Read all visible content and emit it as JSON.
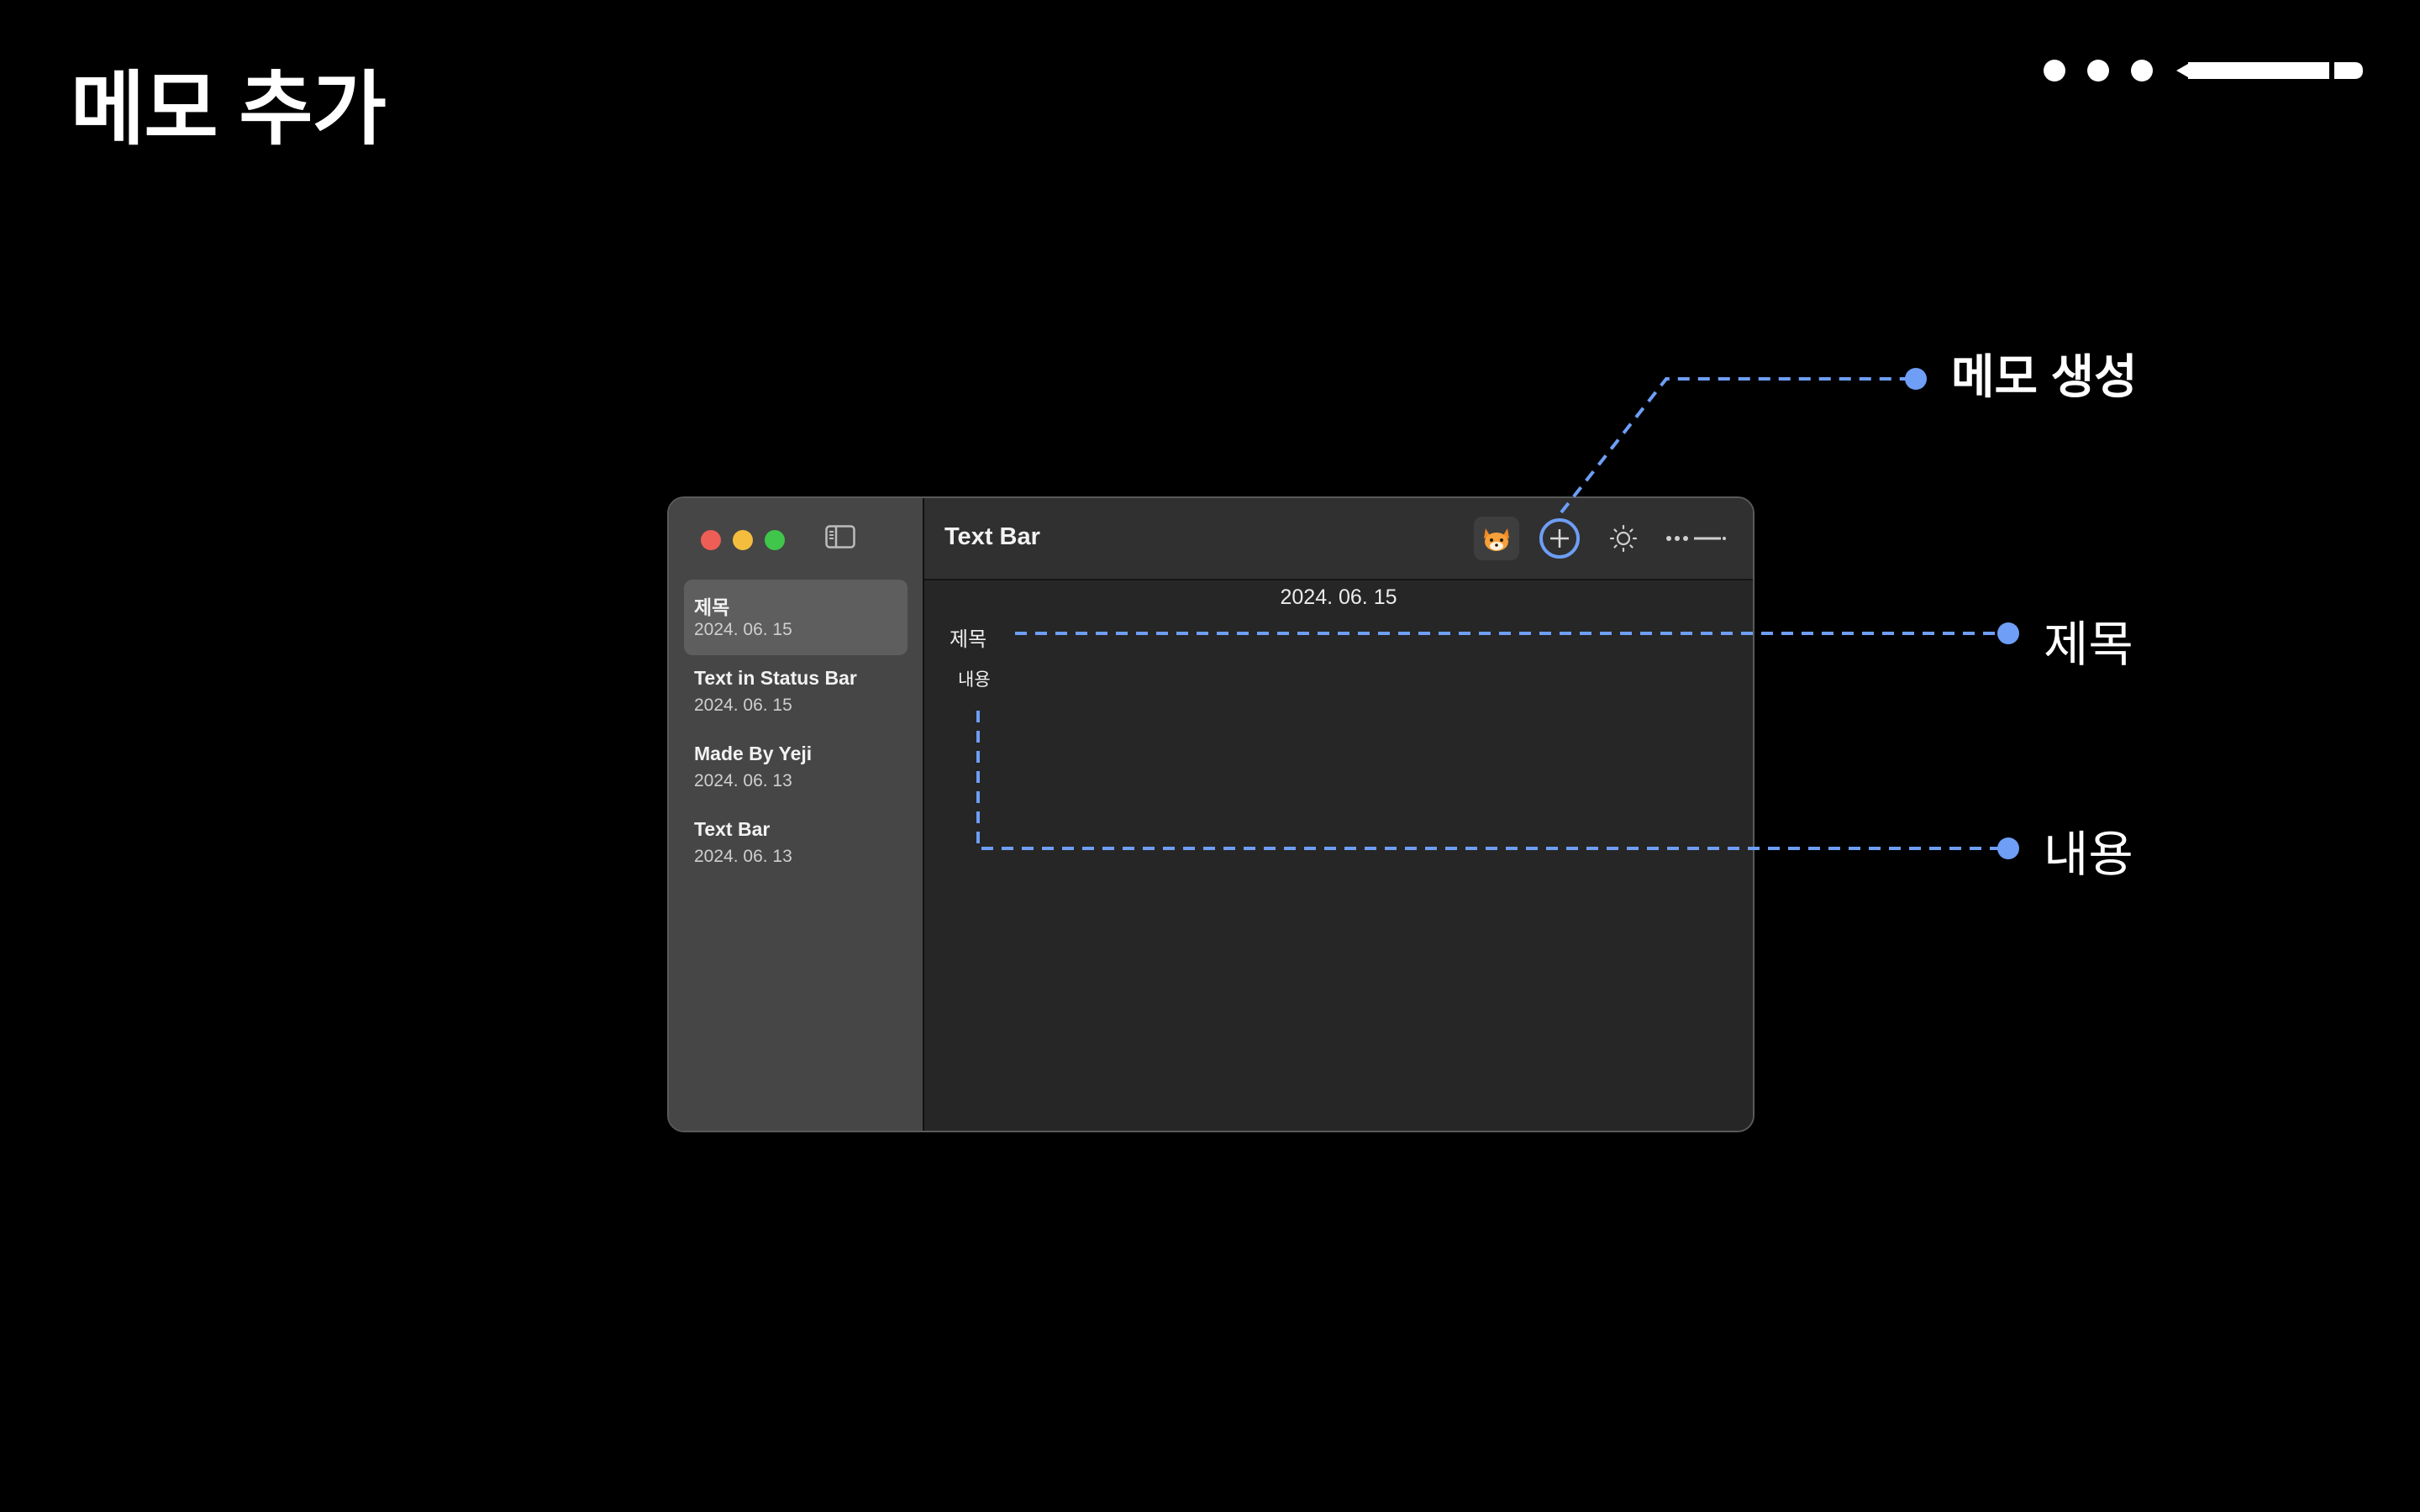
{
  "slide": {
    "title": "메모 추가"
  },
  "window": {
    "controls": {
      "close_color": "#ee5e56",
      "minimize_color": "#f4bd3e",
      "zoom_color": "#3fc64b"
    },
    "sidebar_toggle_icon": "sidebar-toggle-icon",
    "notes": [
      {
        "title": "제목",
        "date": "2024. 06. 15",
        "selected": true
      },
      {
        "title": "Text in Status Bar",
        "date": "2024. 06. 15",
        "selected": false
      },
      {
        "title": "Made By Yeji",
        "date": "2024. 06. 13",
        "selected": false
      },
      {
        "title": "Text Bar",
        "date": "2024. 06. 13",
        "selected": false
      }
    ],
    "toolbar": {
      "title": "Text Bar",
      "icons": [
        "fox-avatar-icon",
        "plus-circle-icon",
        "sun-icon",
        "more-ellipsis-icon"
      ]
    },
    "editor": {
      "date": "2024. 06. 15",
      "title_label": "제목",
      "content_label": "내용"
    }
  },
  "callouts": {
    "create": "메모 생성",
    "title": "제목",
    "content": "내용",
    "line_color": "#6e9ef5"
  }
}
